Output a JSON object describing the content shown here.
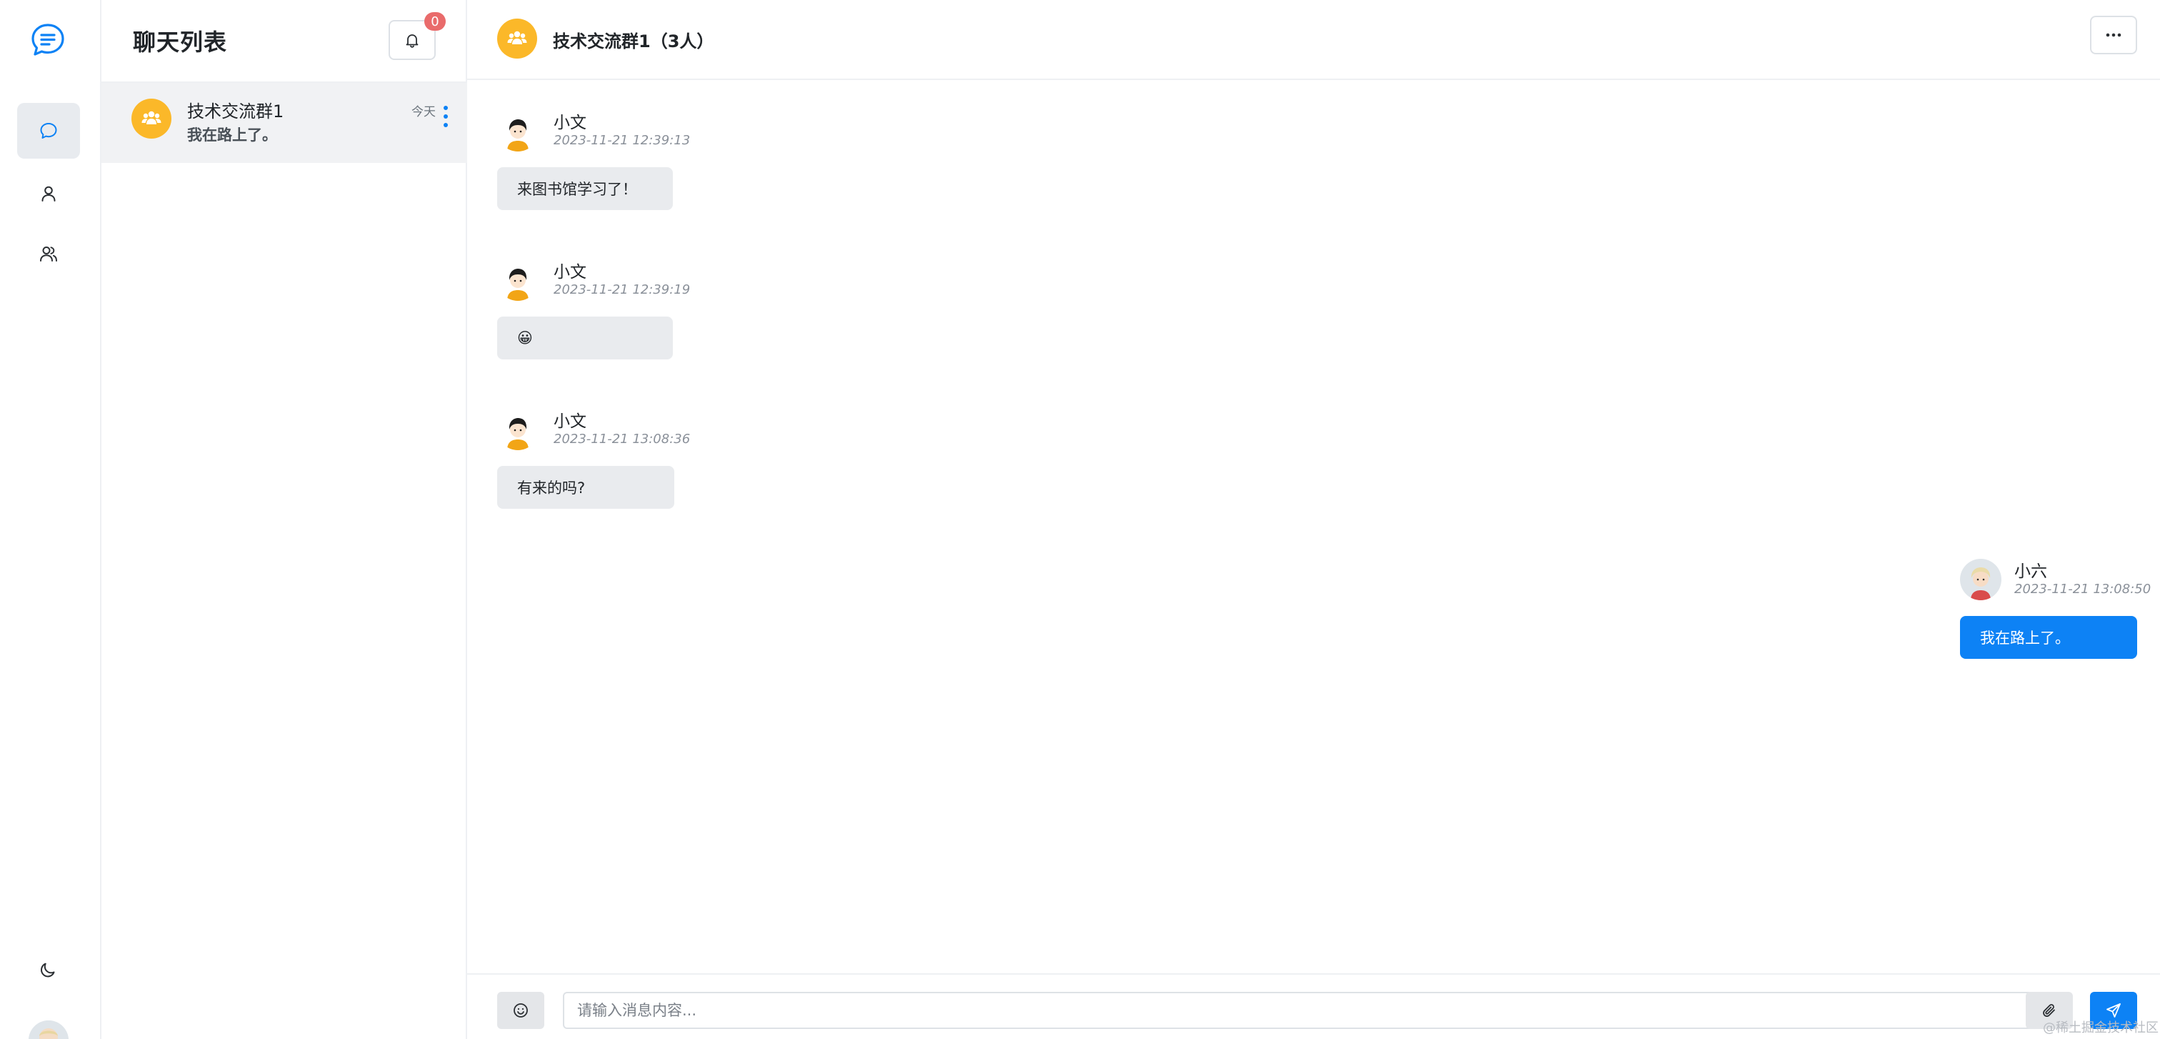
{
  "theme": {
    "accent": "#0d82f5",
    "group_avatar_color": "#fbb829",
    "badge_color": "#e96b6b"
  },
  "rail": {
    "items": [
      {
        "icon": "chat-bubble-icon",
        "active": true
      },
      {
        "icon": "user-icon",
        "active": false
      },
      {
        "icon": "users-icon",
        "active": false
      }
    ],
    "bottom": [
      {
        "icon": "moon-icon"
      }
    ]
  },
  "chat_list": {
    "title": "聊天列表",
    "notification_count": "0",
    "conversations": [
      {
        "name": "技术交流群1",
        "last_message": "我在路上了。",
        "time": "今天"
      }
    ]
  },
  "chat": {
    "title": "技术交流群1（3人）",
    "messages": [
      {
        "sender": "小文",
        "time": "2023-11-21 12:39:13",
        "text": "来图书馆学习了！",
        "direction": "in"
      },
      {
        "sender": "小文",
        "time": "2023-11-21 12:39:19",
        "text": "😀",
        "direction": "in"
      },
      {
        "sender": "小文",
        "time": "2023-11-21 13:08:36",
        "text": "有来的吗?",
        "direction": "in"
      },
      {
        "sender": "小六",
        "time": "2023-11-21 13:08:50",
        "text": "我在路上了。",
        "direction": "out"
      }
    ]
  },
  "composer": {
    "placeholder": "请输入消息内容..."
  },
  "watermark": "@稀土掘金技术社区"
}
